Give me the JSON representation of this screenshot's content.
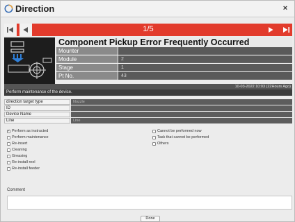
{
  "window": {
    "title": "Direction",
    "close_glyph": "×"
  },
  "navigation": {
    "page_indicator": "1/5",
    "bar_color": "#e23b2c"
  },
  "error": {
    "title": "Component Pickup Error Frequently Occurred",
    "fields": [
      {
        "label": "Mounter",
        "value": ""
      },
      {
        "label": "Module",
        "value": "2"
      },
      {
        "label": "Stage",
        "value": "1"
      },
      {
        "label": "Pt No.",
        "value": "43"
      }
    ],
    "timestamp": "10-03-2022 10:03 (22Hours Ago)",
    "instruction": "Perform maintenance of the device."
  },
  "target": {
    "rows": [
      {
        "label": "direction target type",
        "value": "Nozzle"
      },
      {
        "label": "ID",
        "value": ""
      },
      {
        "label": "Device Name",
        "value": ""
      },
      {
        "label": "Line",
        "value": "Line"
      }
    ]
  },
  "options_left": [
    {
      "label": "Perform as instructed",
      "checked": true
    },
    {
      "label": "Perform maintenance",
      "checked": false
    },
    {
      "label": "Re-insert",
      "checked": false
    },
    {
      "label": "Cleaning",
      "checked": false
    },
    {
      "label": "Greasing",
      "checked": false
    },
    {
      "label": "Re-install reel",
      "checked": false
    },
    {
      "label": "Re-install feeder",
      "checked": false
    }
  ],
  "options_right": [
    {
      "label": "Cannot be performed now",
      "checked": false
    },
    {
      "label": "Task that cannot be performed",
      "checked": false
    },
    {
      "label": "Others",
      "checked": false
    }
  ],
  "comment": {
    "label": "Comment",
    "value": ""
  },
  "done_label": "Done"
}
